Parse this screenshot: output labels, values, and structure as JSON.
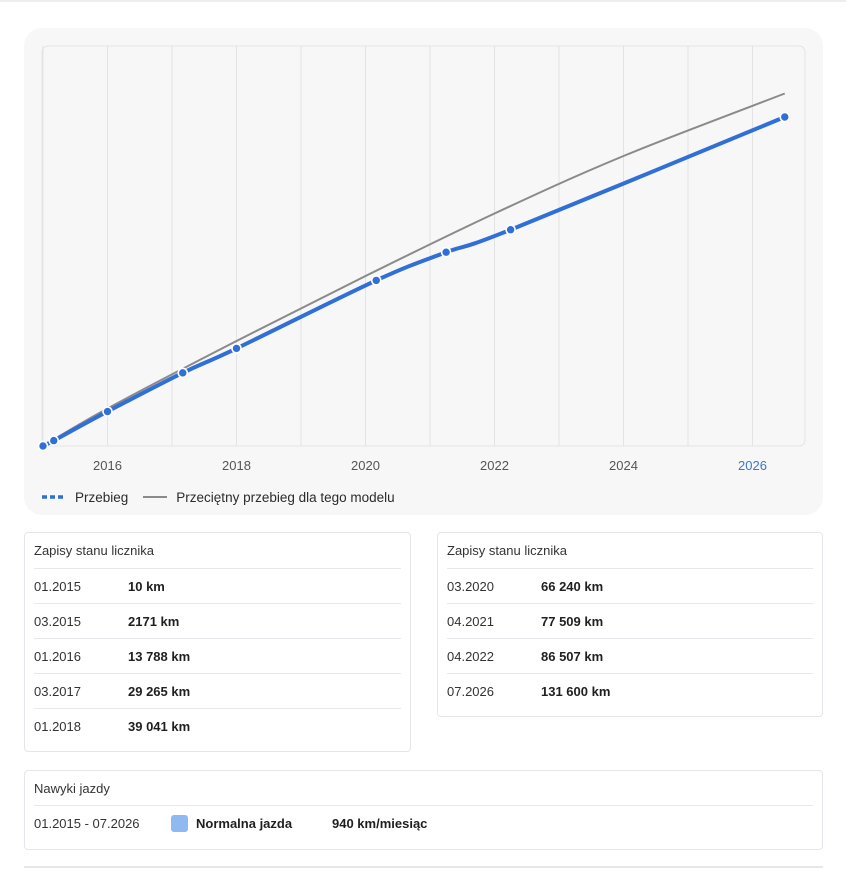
{
  "chart_data": {
    "type": "line",
    "x_ticks": [
      "2016",
      "2018",
      "2020",
      "2022",
      "2024",
      "2026"
    ],
    "highlight_tick": "2026",
    "y_range_km": [
      0,
      160000
    ],
    "grid": "vertical",
    "series": [
      {
        "name": "Przebieg",
        "color": "#2f6fd6",
        "points": [
          {
            "date": "01.2015",
            "km": 10
          },
          {
            "date": "03.2015",
            "km": 2171
          },
          {
            "date": "01.2016",
            "km": 13788
          },
          {
            "date": "03.2017",
            "km": 29265
          },
          {
            "date": "01.2018",
            "km": 39041
          },
          {
            "date": "03.2020",
            "km": 66240
          },
          {
            "date": "04.2021",
            "km": 77509
          },
          {
            "date": "04.2022",
            "km": 86507
          },
          {
            "date": "07.2026",
            "km": 131600
          }
        ]
      },
      {
        "name": "Przeciętny przebieg dla tego modelu",
        "color": "#8a8a8a",
        "points": [
          {
            "date": "01.2015",
            "km": 0
          },
          {
            "date": "01.2016",
            "km": 15000
          },
          {
            "date": "01.2018",
            "km": 42000
          },
          {
            "date": "01.2020",
            "km": 68000
          },
          {
            "date": "01.2022",
            "km": 93000
          },
          {
            "date": "01.2024",
            "km": 116000
          },
          {
            "date": "07.2026",
            "km": 141000
          }
        ]
      }
    ]
  },
  "legend": {
    "series1_label": "Przebieg",
    "series2_label": "Przeciętny przebieg dla tego modelu"
  },
  "records_left": {
    "title": "Zapisy stanu licznika",
    "rows": [
      {
        "date": "01.2015",
        "km": "10 km"
      },
      {
        "date": "03.2015",
        "km": "2171 km"
      },
      {
        "date": "01.2016",
        "km": "13 788 km"
      },
      {
        "date": "03.2017",
        "km": "29 265 km"
      },
      {
        "date": "01.2018",
        "km": "39 041 km"
      }
    ]
  },
  "records_right": {
    "title": "Zapisy stanu licznika",
    "rows": [
      {
        "date": "03.2020",
        "km": "66 240 km"
      },
      {
        "date": "04.2021",
        "km": "77 509 km"
      },
      {
        "date": "04.2022",
        "km": "86 507 km"
      },
      {
        "date": "07.2026",
        "km": "131 600 km"
      }
    ]
  },
  "habits": {
    "title": "Nawyki jazdy",
    "period": "01.2015 - 07.2026",
    "type": "Normalna jazda",
    "rate": "940 km/miesiąc",
    "swatch_color": "#8fb9f1"
  }
}
